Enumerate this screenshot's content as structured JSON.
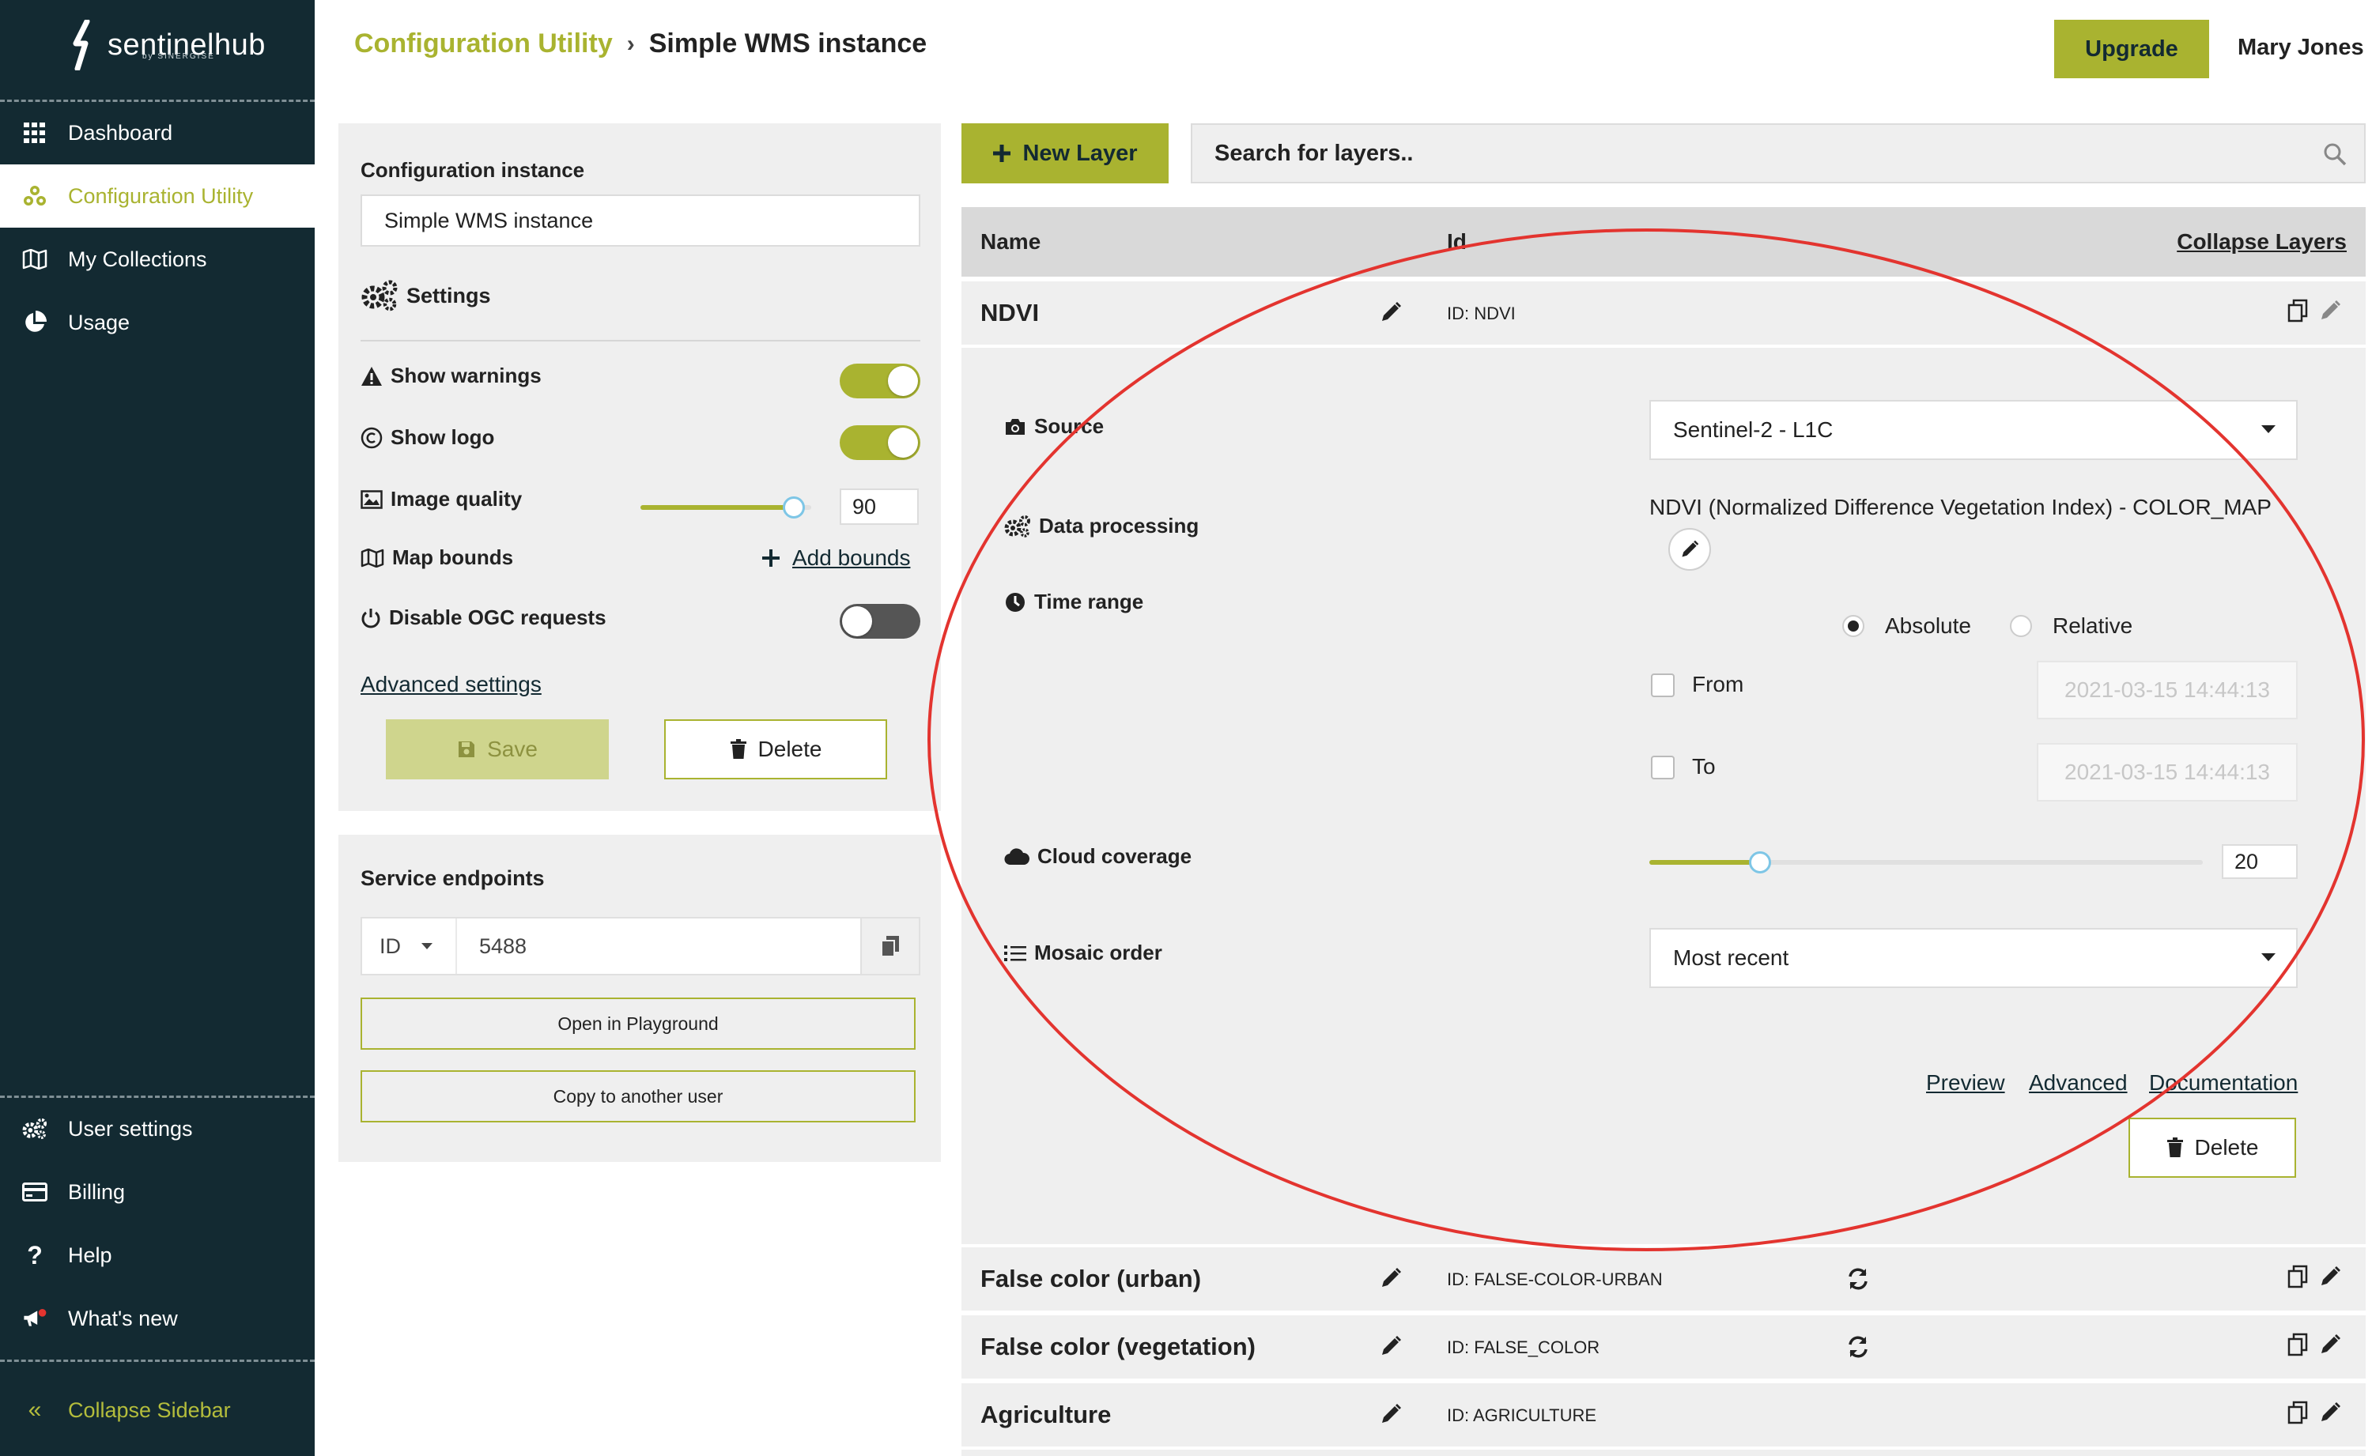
{
  "sidebar": {
    "logo_text": "sentinelhub",
    "logo_sub": "by SINERGISE",
    "items": [
      {
        "label": "Dashboard",
        "icon": "grid-icon"
      },
      {
        "label": "Configuration Utility",
        "icon": "configuration-icon",
        "active": true
      },
      {
        "label": "My Collections",
        "icon": "map-icon"
      },
      {
        "label": "Usage",
        "icon": "pie-chart-icon"
      }
    ],
    "bottom_items": [
      {
        "label": "User settings",
        "icon": "gears-icon"
      },
      {
        "label": "Billing",
        "icon": "credit-card-icon"
      },
      {
        "label": "Help",
        "icon": "question-icon"
      },
      {
        "label": "What's new",
        "icon": "megaphone-icon"
      }
    ],
    "collapse_label": "Collapse Sidebar"
  },
  "header": {
    "breadcrumb_root": "Configuration Utility",
    "breadcrumb_current": "Simple WMS instance",
    "upgrade_label": "Upgrade",
    "user_name": "Mary Jones"
  },
  "config": {
    "instance_label": "Configuration instance",
    "instance_value": "Simple WMS instance",
    "settings_label": "Settings",
    "show_warnings_label": "Show warnings",
    "show_warnings": true,
    "show_logo_label": "Show logo",
    "show_logo": true,
    "image_quality_label": "Image quality",
    "image_quality_value": "90",
    "image_quality_fraction": 0.9,
    "map_bounds_label": "Map bounds",
    "add_bounds_label": "Add bounds",
    "disable_ogc_label": "Disable OGC requests",
    "disable_ogc": false,
    "advanced_settings_label": "Advanced settings",
    "save_label": "Save",
    "delete_label": "Delete"
  },
  "endpoints": {
    "title": "Service endpoints",
    "id_select": "ID",
    "id_value": "5488",
    "open_playground_label": "Open in Playground",
    "copy_user_label": "Copy to another user"
  },
  "layers_toolbar": {
    "new_layer_label": "New Layer",
    "search_placeholder": "Search for layers.."
  },
  "table": {
    "col_name": "Name",
    "col_id": "Id",
    "collapse_label": "Collapse Layers",
    "expanded": {
      "name": "NDVI",
      "id": "ID: NDVI",
      "source_label": "Source",
      "source_value": "Sentinel-2 - L1C",
      "processing_label": "Data processing",
      "processing_value": "NDVI (Normalized Difference Vegetation Index) - COLOR_MAP",
      "time_range_label": "Time range",
      "absolute_label": "Absolute",
      "relative_label": "Relative",
      "time_mode": "Absolute",
      "from_label": "From",
      "from_value": "2021-03-15 14:44:13",
      "to_label": "To",
      "to_value": "2021-03-15 14:44:13",
      "cloud_label": "Cloud coverage",
      "cloud_value": "20",
      "cloud_fraction": 0.2,
      "mosaic_label": "Mosaic order",
      "mosaic_value": "Most recent",
      "preview_label": "Preview",
      "advanced_label": "Advanced",
      "documentation_label": "Documentation",
      "delete_label": "Delete"
    },
    "rows": [
      {
        "name": "False color (urban)",
        "id": "ID: FALSE-COLOR-URBAN"
      },
      {
        "name": "False color (vegetation)",
        "id": "ID: FALSE_COLOR"
      },
      {
        "name": "Agriculture",
        "id": "ID: AGRICULTURE"
      }
    ]
  },
  "colors": {
    "sidebar_bg": "#132a32",
    "accent": "#a9b330",
    "annotation": "#e3342f"
  }
}
